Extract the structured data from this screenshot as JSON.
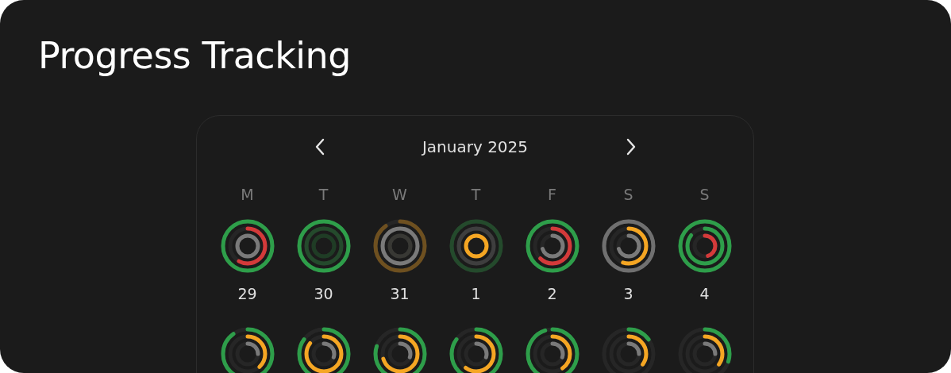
{
  "title": "Progress Tracking",
  "calendar": {
    "month": "January 2025",
    "weekdays": [
      "M",
      "T",
      "W",
      "T",
      "F",
      "S",
      "S"
    ],
    "weeks": [
      {
        "days": [
          {
            "date": "29",
            "rings": [
              {
                "color": "#2e9e4a"
              },
              {
                "color": "#d43a3a"
              },
              {
                "color": "#7a7a7a"
              }
            ]
          },
          {
            "date": "30",
            "rings": [
              {
                "color": "#2e9e4a"
              },
              {
                "color": "#244a2c"
              },
              {
                "color": "#1f3c25"
              }
            ]
          },
          {
            "date": "31",
            "rings": [
              {
                "color": "#6e5020"
              },
              {
                "color": "#7a7a7a"
              },
              {
                "color": "#383834"
              }
            ]
          },
          {
            "date": "1",
            "rings": [
              {
                "color": "#244a2c"
              },
              {
                "color": "#3e3e3e"
              },
              {
                "color": "#f5a623"
              }
            ]
          },
          {
            "date": "2",
            "rings": [
              {
                "color": "#2e9e4a"
              },
              {
                "color": "#d43a3a"
              },
              {
                "color": "#7a7a7a"
              }
            ]
          },
          {
            "date": "3",
            "rings": [
              {
                "color": "#707070"
              },
              {
                "color": "#f5a623"
              },
              {
                "color": "#7a7a7a"
              }
            ]
          },
          {
            "date": "4",
            "rings": [
              {
                "color": "#2e9e4a"
              },
              {
                "color": "#2e9e4a"
              },
              {
                "color": "#d43a3a"
              }
            ]
          }
        ]
      },
      {
        "days": [
          {
            "rings": [
              {
                "color": "#2e9e4a"
              },
              {
                "color": "#f5a623"
              },
              {
                "color": "#7a7a7a"
              }
            ]
          },
          {
            "rings": [
              {
                "color": "#2e9e4a"
              },
              {
                "color": "#f5a623"
              },
              {
                "color": "#7a7a7a"
              }
            ]
          },
          {
            "rings": [
              {
                "color": "#2e9e4a"
              },
              {
                "color": "#f5a623"
              },
              {
                "color": "#7a7a7a"
              }
            ]
          },
          {
            "rings": [
              {
                "color": "#2e9e4a"
              },
              {
                "color": "#f5a623"
              },
              {
                "color": "#7a7a7a"
              }
            ]
          },
          {
            "rings": [
              {
                "color": "#2e9e4a"
              },
              {
                "color": "#f5a623"
              },
              {
                "color": "#7a7a7a"
              }
            ]
          },
          {
            "rings": [
              {
                "color": "#2e9e4a"
              },
              {
                "color": "#f5a623"
              },
              {
                "color": "#7a7a7a"
              }
            ]
          },
          {
            "rings": [
              {
                "color": "#2e9e4a"
              },
              {
                "color": "#f5a623"
              },
              {
                "color": "#7a7a7a"
              }
            ]
          }
        ]
      }
    ]
  }
}
